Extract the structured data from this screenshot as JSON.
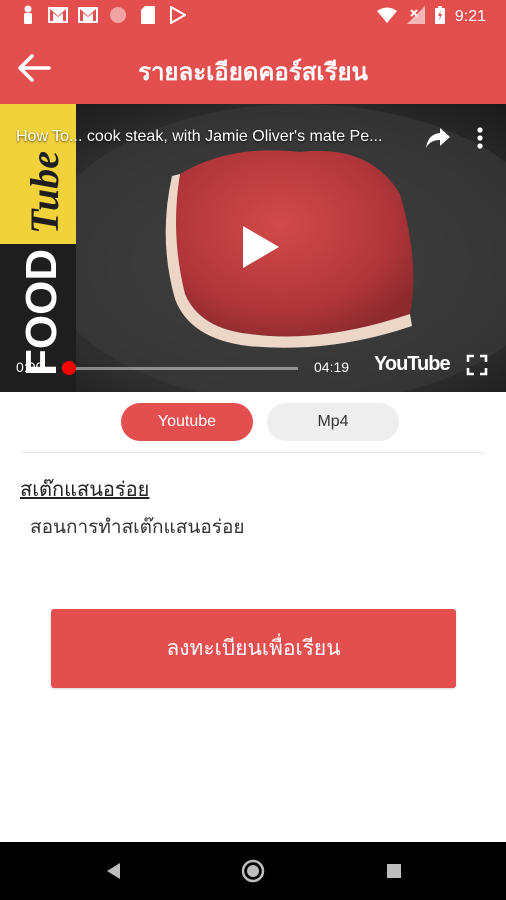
{
  "status_bar": {
    "time": "9:21",
    "colors": {
      "background": "#e34f4f"
    },
    "left_icons": [
      "person-icon",
      "gmail-icon",
      "gmail-icon",
      "circle-icon",
      "sd-card-icon",
      "play-store-icon"
    ],
    "right_icons": [
      "wifi-icon",
      "signal-icon",
      "battery-icon"
    ]
  },
  "app_bar": {
    "title": "รายละเอียดคอร์สเรียน",
    "back_icon": "arrow-left-icon"
  },
  "video": {
    "title": "How To... cook steak, with Jamie Oliver's mate Pe...",
    "current_time": "0:00",
    "duration": "04:19",
    "progress": 0,
    "brand": "YouTube",
    "channel_logo_text": "FOOD Tube"
  },
  "source_toggle": {
    "options": [
      "Youtube",
      "Mp4"
    ],
    "selected": "Youtube"
  },
  "course": {
    "name": "สเต๊กแสนอร่อย",
    "description": "สอนการทำสเต๊กแสนอร่อย"
  },
  "register_button": {
    "label": "ลงทะเบียนเพื่อเรียน"
  },
  "colors": {
    "primary": "#e34f4f",
    "toggle_inactive": "#eeeeee",
    "progress": "#ff0000"
  }
}
